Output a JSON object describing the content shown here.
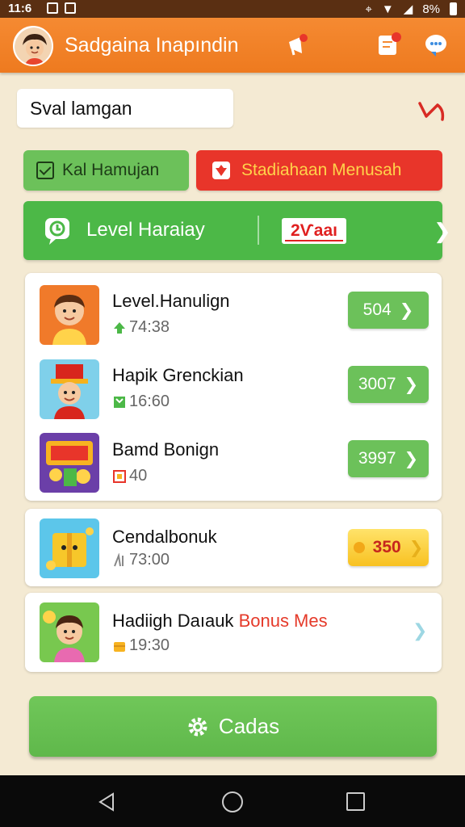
{
  "status_bar": {
    "time": "11:6",
    "battery": "8%"
  },
  "app": {
    "title": "Sadgaina Inapındin"
  },
  "search": {
    "value": "Sval lamgan"
  },
  "actions": {
    "green_label": "Kal Hamujan",
    "red_label": "Stadiahaan Menusah"
  },
  "level": {
    "label": "Level Haraiay",
    "badge": "2Ѵaaı"
  },
  "items": [
    {
      "title": "Level.Hanulign",
      "sub": "74:38",
      "button": "504",
      "sub_icon": "level-up-icon",
      "thumb": "boy-avatar"
    },
    {
      "title": "Hapik Grenckian",
      "sub": "16:60",
      "button": "3007",
      "sub_icon": "book-icon",
      "thumb": "magician-avatar"
    },
    {
      "title": "Bamd Bonign",
      "sub": "40",
      "button": "3997",
      "sub_icon": "badge-icon",
      "thumb": "slot-game"
    },
    {
      "title": "Cendalbonuk",
      "sub": "73:00",
      "button": "350",
      "sub_icon": "trend-icon",
      "thumb": "gift-box"
    },
    {
      "title_main": "Hadiigh Daıauk",
      "title_highlight": "Bonus Mes",
      "sub": "19:30",
      "sub_icon": "coin-stack-icon",
      "thumb": "kid-avatar"
    }
  ],
  "bottom": {
    "label": "Cadas"
  },
  "colors": {
    "orange": "#f58a32",
    "green": "#4cb847",
    "red": "#e8352a",
    "gold": "#f8c121"
  }
}
